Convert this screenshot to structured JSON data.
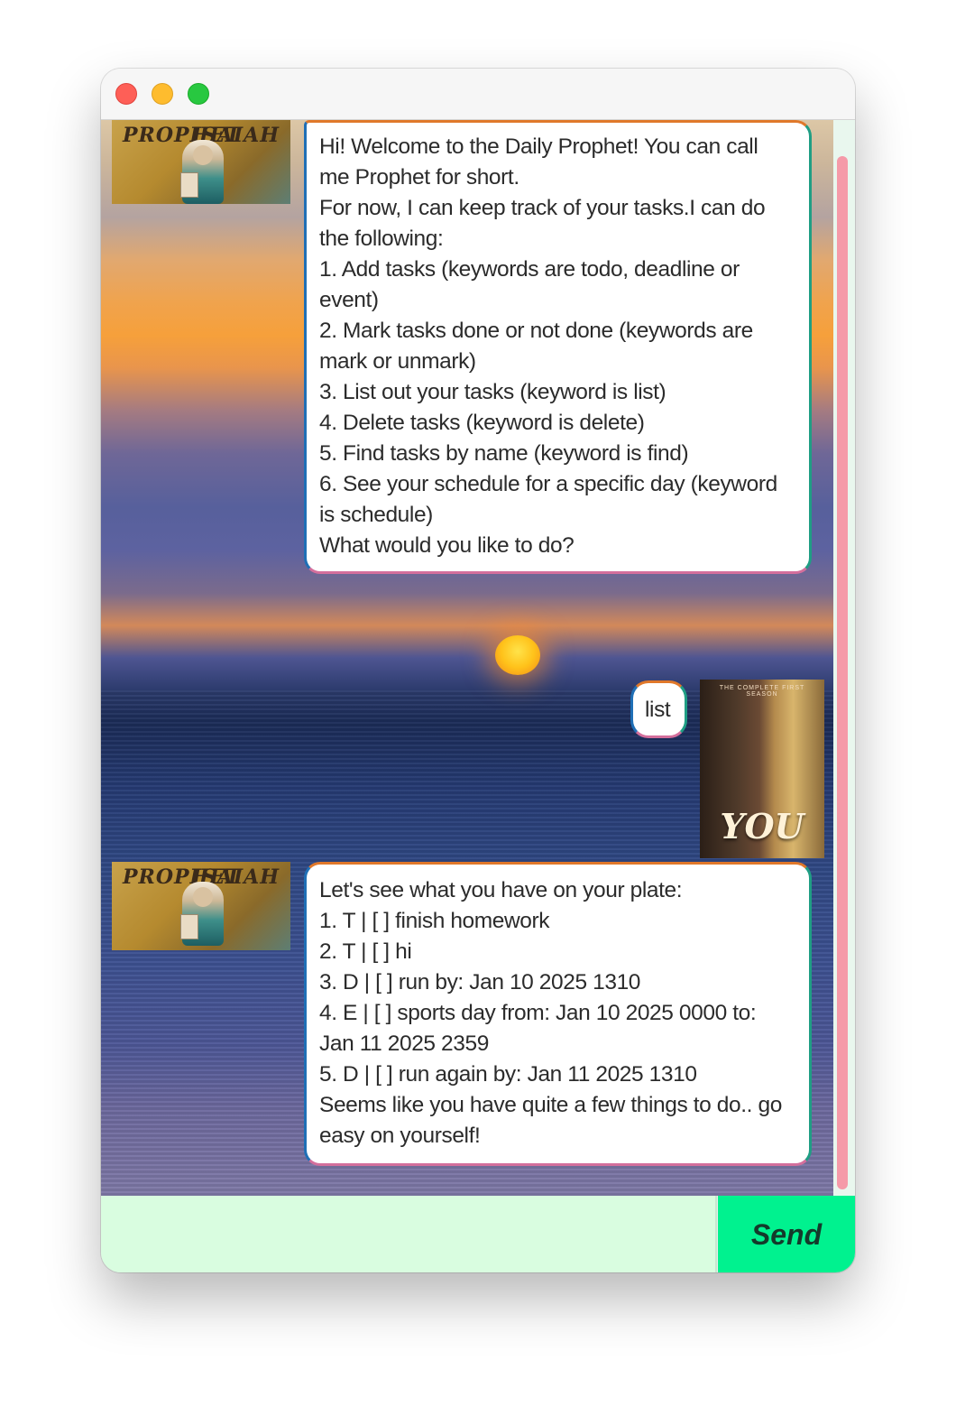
{
  "window": {
    "controls": [
      "close",
      "minimize",
      "maximize"
    ]
  },
  "bot_avatar": {
    "left_text": "PROPHET",
    "right_text": "ISAIAH"
  },
  "user_avatar": {
    "small_text": "THE COMPLETE FIRST SEASON",
    "title": "YOU"
  },
  "messages": [
    {
      "sender": "bot",
      "lines": [
        "Hi! Welcome to the Daily Prophet! You can call",
        "me Prophet for short.",
        "For now, I can keep track of your tasks.I can do",
        "the following:",
        "1. Add tasks (keywords are todo, deadline or",
        "event)",
        "2. Mark tasks done or not done (keywords are",
        "mark or unmark)",
        "3. List out your tasks (keyword is list)",
        "4. Delete tasks (keyword is delete)",
        "5. Find tasks by name (keyword is find)",
        "6. See your schedule for a specific day (keyword",
        "is schedule)",
        "What would you like to do?"
      ]
    },
    {
      "sender": "user",
      "lines": [
        "list"
      ]
    },
    {
      "sender": "bot",
      "lines": [
        "Let's see what you have on your plate:",
        "1. T | [ ] finish homework",
        "2. T | [ ] hi",
        "3. D | [ ] run by: Jan 10 2025 1310",
        "4. E | [ ] sports day from: Jan 10 2025 0000 to:",
        "Jan 11 2025 2359",
        "5. D | [ ] run again by: Jan 11 2025 1310",
        "Seems like you have quite a few things to do.. go",
        "easy on yourself!"
      ]
    }
  ],
  "input": {
    "value": "",
    "placeholder": ""
  },
  "send_button": {
    "label": "Send"
  },
  "colors": {
    "send_button_bg": "#00f28f",
    "input_bg": "#d9fde0",
    "scroll_thumb": "#f59aa8"
  }
}
